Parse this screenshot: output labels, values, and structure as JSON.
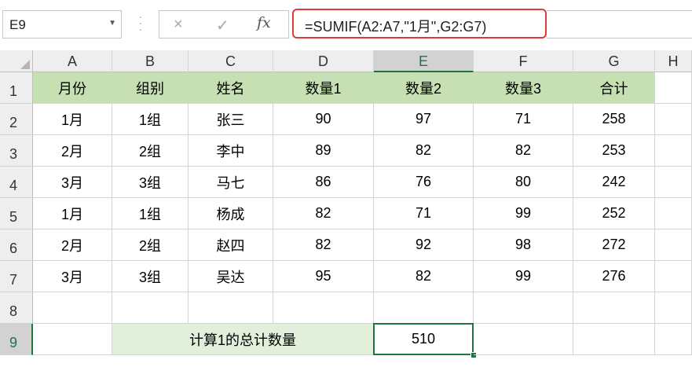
{
  "name_box": {
    "value": "E9"
  },
  "formula_bar": {
    "formula": "=SUMIF(A2:A7,\"1月\",G2:G7)",
    "cancel_icon": "×",
    "enter_icon": "✓",
    "fx_icon": "fx"
  },
  "columns": [
    "A",
    "B",
    "C",
    "D",
    "E",
    "F",
    "G",
    "H"
  ],
  "rows": [
    "1",
    "2",
    "3",
    "4",
    "5",
    "6",
    "7",
    "8",
    "9"
  ],
  "table": {
    "headers": [
      "月份",
      "组别",
      "姓名",
      "数量1",
      "数量2",
      "数量3",
      "合计"
    ],
    "data": [
      [
        "1月",
        "1组",
        "张三",
        "90",
        "97",
        "71",
        "258"
      ],
      [
        "2月",
        "2组",
        "李中",
        "89",
        "82",
        "82",
        "253"
      ],
      [
        "3月",
        "3组",
        "马七",
        "86",
        "76",
        "80",
        "242"
      ],
      [
        "1月",
        "1组",
        "杨成",
        "82",
        "71",
        "99",
        "252"
      ],
      [
        "2月",
        "2组",
        "赵四",
        "82",
        "92",
        "98",
        "272"
      ],
      [
        "3月",
        "3组",
        "吴达",
        "95",
        "82",
        "99",
        "276"
      ]
    ]
  },
  "summary": {
    "label": "计算1的总计数量",
    "value": "510"
  },
  "selection": {
    "active_cell": "E9",
    "column": "E",
    "row": "9"
  },
  "colors": {
    "header_fill": "#c6e0b4",
    "summary_fill": "#e2efda",
    "selection_green": "#217346",
    "formula_highlight": "#e0393e"
  }
}
